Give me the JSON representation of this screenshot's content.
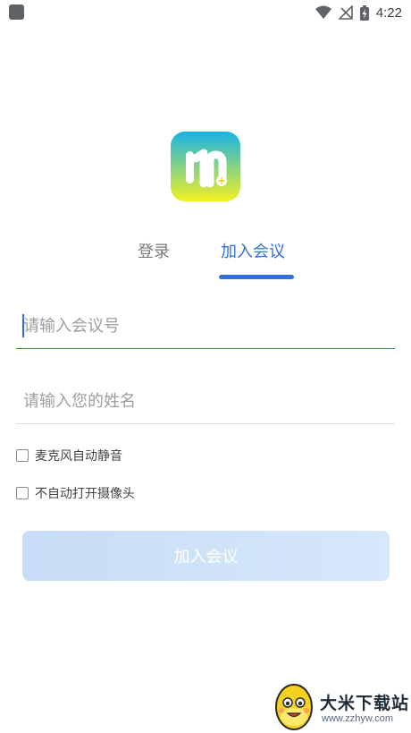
{
  "status_bar": {
    "time": "4:22",
    "icons": [
      "app-notification-icon",
      "wifi-icon",
      "no-signal-icon",
      "battery-charging-icon"
    ]
  },
  "app": {
    "logo_icon": "m-logo-icon",
    "brand_colors": {
      "primary": "#2f6fde",
      "logo_gradient_start": "#16b3e6",
      "logo_gradient_end": "#f3f021"
    }
  },
  "tabs": [
    {
      "label": "登录",
      "active": false
    },
    {
      "label": "加入会议",
      "active": true
    }
  ],
  "form": {
    "meeting_id": {
      "value": "",
      "placeholder": "请输入会议号"
    },
    "name": {
      "value": "",
      "placeholder": "请输入您的姓名"
    },
    "options": [
      {
        "label": "麦克风自动静音",
        "checked": false
      },
      {
        "label": "不自动打开摄像头",
        "checked": false
      }
    ],
    "submit_label": "加入会议"
  },
  "watermark": {
    "title": "大米下载站",
    "url": "www.zzhyw.com"
  }
}
